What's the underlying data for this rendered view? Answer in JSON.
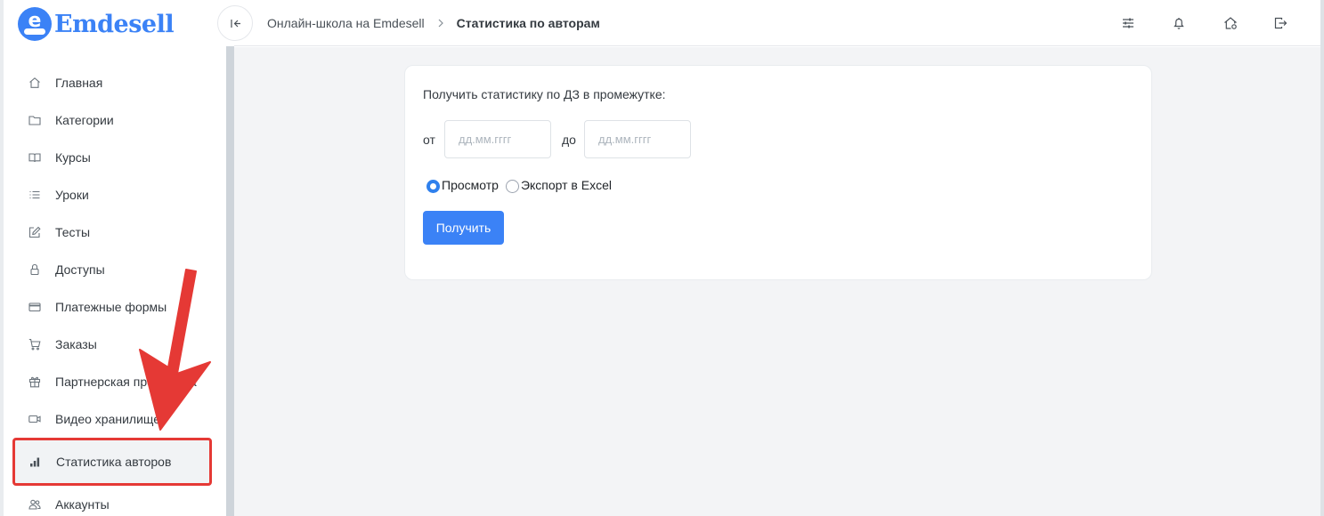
{
  "app": {
    "brand": "Emdesell",
    "logo_letter": "e",
    "brand_color": "#3b82f6",
    "accent_color": "#3b82f6",
    "annotation_color": "#e53935"
  },
  "sidebar": {
    "items": [
      {
        "label": "Главная",
        "icon": "home-icon"
      },
      {
        "label": "Категории",
        "icon": "folder-icon"
      },
      {
        "label": "Курсы",
        "icon": "book-icon"
      },
      {
        "label": "Уроки",
        "icon": "list-icon"
      },
      {
        "label": "Тесты",
        "icon": "edit-icon"
      },
      {
        "label": "Доступы",
        "icon": "lock-icon"
      },
      {
        "label": "Платежные формы",
        "icon": "credit-card-icon"
      },
      {
        "label": "Заказы",
        "icon": "cart-icon"
      },
      {
        "label": "Партнерская программа",
        "icon": "gift-icon"
      },
      {
        "label": "Видео хранилище",
        "icon": "video-icon"
      },
      {
        "label": "Статистика авторов",
        "icon": "bar-chart-icon",
        "active": true
      },
      {
        "label": "Аккаунты",
        "icon": "users-icon"
      }
    ]
  },
  "header": {
    "breadcrumb": [
      {
        "label": "Онлайн-школа на Emdesell"
      },
      {
        "label": "Статистика по авторам"
      }
    ],
    "icons": [
      "sliders-icon",
      "bell-icon",
      "home-settings-icon",
      "logout-icon"
    ]
  },
  "form": {
    "title": "Получить статистику по ДЗ в промежутке:",
    "from_label": "от",
    "to_label": "до",
    "from_placeholder": "дд.мм.гггг",
    "to_placeholder": "дд.мм.гггг",
    "from_value": "",
    "to_value": "",
    "options": [
      {
        "label": "Просмотр",
        "selected": true
      },
      {
        "label": "Экспорт в Excel",
        "selected": false
      }
    ],
    "submit_label": "Получить"
  }
}
